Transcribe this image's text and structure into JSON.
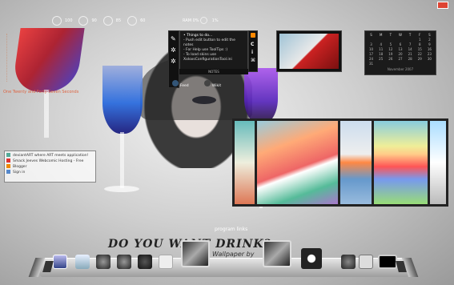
{
  "topbar": {
    "gauges": [
      {
        "label": "100"
      },
      {
        "label": "90"
      },
      {
        "label": "85"
      },
      {
        "label": "60"
      }
    ],
    "ram_label": "RAM",
    "ram_values": [
      "0%",
      "1%"
    ]
  },
  "notes": {
    "title": "• Things to do...",
    "items": [
      "- Push edit button to edit the notes",
      "- For Help use ToolTips :)",
      "- To load skins use",
      "XoloxsConfigurationTool.ini"
    ],
    "footer": "NOTES"
  },
  "feeds": [
    {
      "label": "Feed"
    },
    {
      "label": "Wikit"
    }
  ],
  "calendar": {
    "headers": [
      "S",
      "M",
      "T",
      "W",
      "T",
      "F",
      "S"
    ],
    "days": [
      "",
      "",
      "",
      "",
      "",
      "1",
      "2",
      "3",
      "4",
      "5",
      "6",
      "7",
      "8",
      "9",
      "10",
      "11",
      "12",
      "13",
      "14",
      "15",
      "16",
      "17",
      "18",
      "19",
      "20",
      "21",
      "22",
      "23",
      "24",
      "25",
      "26",
      "27",
      "28",
      "29",
      "30",
      "31"
    ],
    "footer": "November 2007"
  },
  "left_texts": [
    "One Twenty and Forty-Seven Seconds"
  ],
  "links": [
    {
      "label": "deviantART where ART meets application!",
      "color": "#5a9"
    },
    {
      "label": "Smack Jeeves Webcomic Hosting - Free",
      "color": "#d33"
    },
    {
      "label": "Blogger",
      "color": "#e80"
    },
    {
      "label": "Sign in",
      "color": "#58c"
    }
  ],
  "program_links_label": "program links",
  "slogan": "DO YOU WANT DRINK?",
  "slogan_sub": "Wallpaper by",
  "dock": {
    "items": [
      {
        "name": "computer"
      },
      {
        "name": "recycle-bin"
      },
      {
        "name": "settings-a"
      },
      {
        "name": "settings-b"
      },
      {
        "name": "browser"
      },
      {
        "name": "blank"
      },
      {
        "name": "package-a"
      },
      {
        "name": "package-b"
      },
      {
        "name": "gear"
      },
      {
        "name": "tool"
      },
      {
        "name": "explorer"
      },
      {
        "name": "terminal"
      }
    ]
  },
  "colors": {
    "accent": "#d64",
    "panel_dark": "#1b1b1b",
    "dock": "#cfcfcf"
  }
}
